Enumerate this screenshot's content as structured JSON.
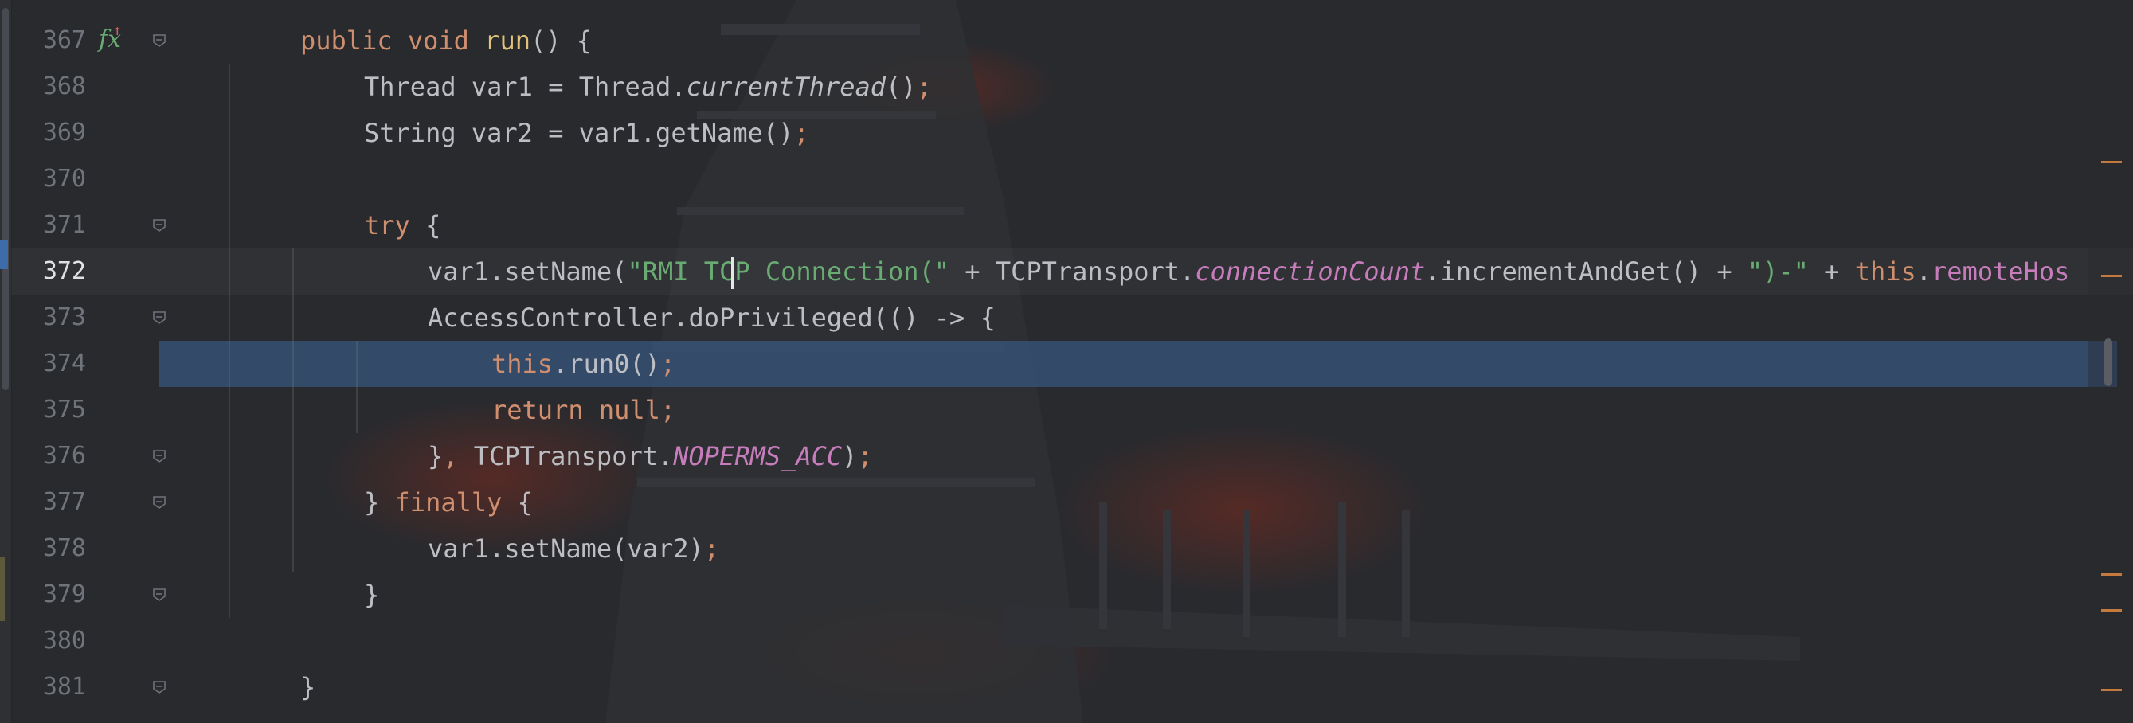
{
  "editor": {
    "gutter_icon": "override-lambda-icon",
    "lines": [
      {
        "num": "367",
        "tokens": [
          [
            "kw",
            "public "
          ],
          [
            "kw",
            "void "
          ],
          [
            "mcall",
            "run"
          ],
          [
            "p",
            "() {"
          ]
        ]
      },
      {
        "num": "368",
        "tokens": [
          [
            "p",
            "Thread var1 = Thread."
          ],
          [
            "static",
            "currentThread"
          ],
          [
            "p",
            "()"
          ],
          [
            "semi",
            ";"
          ]
        ]
      },
      {
        "num": "369",
        "tokens": [
          [
            "p",
            "String var2 = var1.getName()"
          ],
          [
            "semi",
            ";"
          ]
        ]
      },
      {
        "num": "370",
        "tokens": []
      },
      {
        "num": "371",
        "tokens": [
          [
            "kw",
            "try "
          ],
          [
            "p",
            "{"
          ]
        ]
      },
      {
        "num": "372",
        "tokens": [
          [
            "p",
            "var1.setName("
          ],
          [
            "str",
            "\"RMI TCP Connection(\""
          ],
          [
            "p",
            " + TCPTransport."
          ],
          [
            "ital",
            "connectionCount"
          ],
          [
            "p",
            ".incrementAndGet() + "
          ],
          [
            "str",
            "\")-\""
          ],
          [
            "p",
            " + "
          ],
          [
            "kw",
            "this"
          ],
          [
            "p",
            "."
          ],
          [
            "field",
            "remoteHos"
          ]
        ]
      },
      {
        "num": "373",
        "tokens": [
          [
            "p",
            "AccessController.doPrivileged(() -> {"
          ]
        ]
      },
      {
        "num": "374",
        "tokens": [
          [
            "kw",
            "this"
          ],
          [
            "p",
            ".run0()"
          ],
          [
            "semi",
            ";"
          ]
        ]
      },
      {
        "num": "375",
        "tokens": [
          [
            "kw",
            "return null"
          ],
          [
            "semi",
            ";"
          ]
        ]
      },
      {
        "num": "376",
        "tokens": [
          [
            "p",
            "}"
          ],
          [
            "semi",
            ", "
          ],
          [
            "p",
            "TCPTransport."
          ],
          [
            "ital",
            "NOPERMS_ACC"
          ],
          [
            "p",
            ")"
          ],
          [
            "semi",
            ";"
          ]
        ]
      },
      {
        "num": "377",
        "tokens": [
          [
            "p",
            "} "
          ],
          [
            "kw",
            "finally "
          ],
          [
            "p",
            "{"
          ]
        ]
      },
      {
        "num": "378",
        "tokens": [
          [
            "p",
            "var1.setName(var2)"
          ],
          [
            "semi",
            ";"
          ]
        ]
      },
      {
        "num": "379",
        "tokens": [
          [
            "p",
            "}"
          ]
        ]
      },
      {
        "num": "380",
        "tokens": []
      },
      {
        "num": "381",
        "tokens": [
          [
            "p",
            "}"
          ]
        ]
      }
    ],
    "indent": [
      1,
      2,
      2,
      0,
      2,
      3,
      3,
      4,
      4,
      3,
      2,
      3,
      2,
      0,
      1
    ],
    "fold_lines": [
      0,
      4,
      6,
      9,
      10,
      12,
      14
    ],
    "current_line_index": 5,
    "execution_line_index": 7,
    "colors": {
      "keyword": "#cf8e6d",
      "string": "#6aab73",
      "field": "#c77dbb",
      "exec_highlight": "#37557d"
    }
  }
}
